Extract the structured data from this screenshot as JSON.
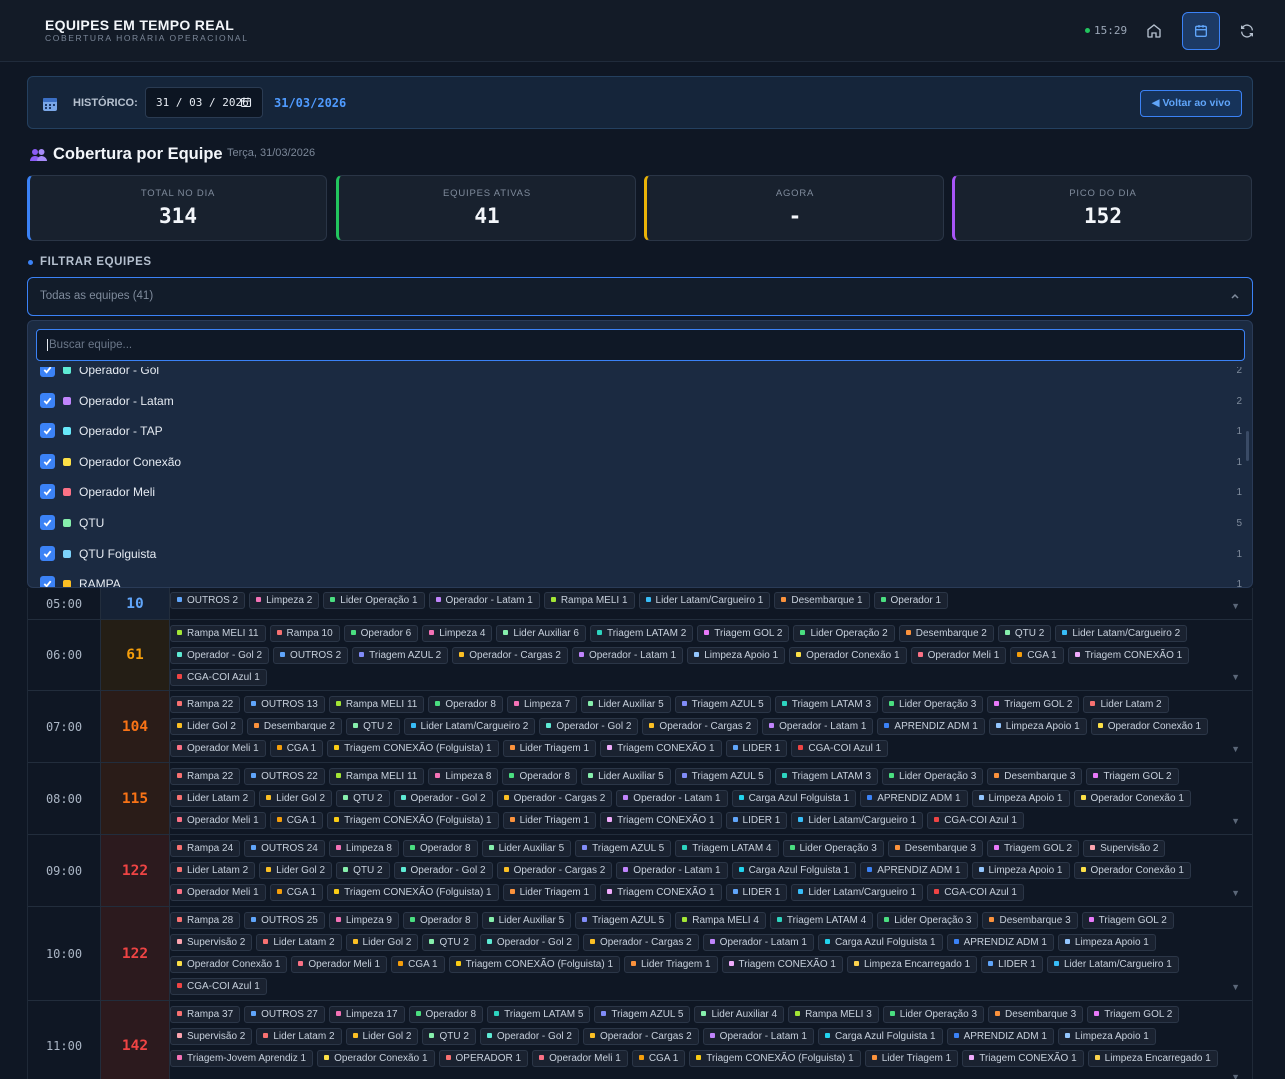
{
  "header": {
    "title": "EQUIPES EM TEMPO REAL",
    "subtitle": "COBERTURA HORÁRIA OPERACIONAL",
    "clock": "15:29"
  },
  "history": {
    "label": "HISTÓRICO:",
    "date_value": "31 / 03 / 2026",
    "date_display": "31/03/2026",
    "live_button": "◀ Voltar ao vivo"
  },
  "section": {
    "title": "Cobertura por Equipe",
    "date": "Terça, 31/03/2026"
  },
  "stats": [
    {
      "label": "TOTAL NO DIA",
      "value": "314"
    },
    {
      "label": "EQUIPES ATIVAS",
      "value": "41"
    },
    {
      "label": "AGORA",
      "value": "-"
    },
    {
      "label": "PICO DO DIA",
      "value": "152"
    }
  ],
  "filter": {
    "title": "FILTRAR EQUIPES",
    "selected": "Todas as equipes (41)",
    "search_placeholder": "Buscar equipe...",
    "items": [
      {
        "name": "Operador - Gol",
        "count": "2",
        "color": "#5eead4"
      },
      {
        "name": "Operador - Latam",
        "count": "2",
        "color": "#c084fc"
      },
      {
        "name": "Operador - TAP",
        "count": "1",
        "color": "#67e8f9"
      },
      {
        "name": "Operador Conexão",
        "count": "1",
        "color": "#fde047"
      },
      {
        "name": "Operador Meli",
        "count": "1",
        "color": "#fb7185"
      },
      {
        "name": "QTU",
        "count": "5",
        "color": "#86efac"
      },
      {
        "name": "QTU Folguista",
        "count": "1",
        "color": "#7dd3fc"
      },
      {
        "name": "RAMPA",
        "count": "1",
        "color": "#fbbf24"
      }
    ]
  },
  "hours": [
    {
      "hour": "05:00",
      "count": "10",
      "count_color": "#60a5fa",
      "bg": "#162235",
      "tags": [
        [
          "OUTROS 2",
          "#60a5fa"
        ],
        [
          "Limpeza 2",
          "#f472b6"
        ],
        [
          "Lider Operação 1",
          "#4ade80"
        ],
        [
          "Operador - Latam 1",
          "#c084fc"
        ],
        [
          "Rampa MELI 1",
          "#a3e635"
        ],
        [
          "Lider Latam/Cargueiro 1",
          "#38bdf8"
        ],
        [
          "Desembarque 1",
          "#fb923c"
        ],
        [
          "Operador 1",
          "#4ade80"
        ]
      ]
    },
    {
      "hour": "06:00",
      "count": "61",
      "count_color": "#f59e0b",
      "bg": "#241e15",
      "tags": [
        [
          "Rampa MELI 11",
          "#a3e635"
        ],
        [
          "Rampa 10",
          "#f87171"
        ],
        [
          "Operador 6",
          "#4ade80"
        ],
        [
          "Limpeza 4",
          "#f472b6"
        ],
        [
          "Lider Auxiliar 6",
          "#86efac"
        ],
        [
          "Triagem LATAM 2",
          "#2dd4bf"
        ],
        [
          "Triagem GOL 2",
          "#e879f9"
        ],
        [
          "Lider Operação 2",
          "#4ade80"
        ],
        [
          "Desembarque 2",
          "#fb923c"
        ],
        [
          "QTU 2",
          "#86efac"
        ],
        [
          "Lider Latam/Cargueiro 2",
          "#38bdf8"
        ],
        [
          "Operador - Gol 2",
          "#5eead4"
        ],
        [
          "OUTROS 2",
          "#60a5fa"
        ],
        [
          "Triagem AZUL 2",
          "#818cf8"
        ],
        [
          "Operador - Cargas 2",
          "#fbbf24"
        ],
        [
          "Operador - Latam 1",
          "#c084fc"
        ],
        [
          "Limpeza Apoio 1",
          "#93c5fd"
        ],
        [
          "Operador Conexão 1",
          "#fde047"
        ],
        [
          "Operador Meli 1",
          "#fb7185"
        ],
        [
          "CGA 1",
          "#f59e0b"
        ],
        [
          "Triagem CONEXÃO 1",
          "#f0abfc"
        ],
        [
          "CGA-COI Azul 1",
          "#ef4444"
        ]
      ]
    },
    {
      "hour": "07:00",
      "count": "104",
      "count_color": "#f97316",
      "bg": "#2a1c18",
      "tags": [
        [
          "Rampa 22",
          "#f87171"
        ],
        [
          "OUTROS 13",
          "#60a5fa"
        ],
        [
          "Rampa MELI 11",
          "#a3e635"
        ],
        [
          "Operador 8",
          "#4ade80"
        ],
        [
          "Limpeza 7",
          "#f472b6"
        ],
        [
          "Lider Auxiliar 5",
          "#86efac"
        ],
        [
          "Triagem AZUL 5",
          "#818cf8"
        ],
        [
          "Triagem LATAM 3",
          "#2dd4bf"
        ],
        [
          "Lider Operação 3",
          "#4ade80"
        ],
        [
          "Triagem GOL 2",
          "#e879f9"
        ],
        [
          "Lider Latam 2",
          "#f87171"
        ],
        [
          "Lider Gol 2",
          "#fbbf24"
        ],
        [
          "Desembarque 2",
          "#fb923c"
        ],
        [
          "QTU 2",
          "#86efac"
        ],
        [
          "Lider Latam/Cargueiro 2",
          "#38bdf8"
        ],
        [
          "Operador - Gol 2",
          "#5eead4"
        ],
        [
          "Operador - Cargas 2",
          "#fbbf24"
        ],
        [
          "Operador - Latam 1",
          "#c084fc"
        ],
        [
          "APRENDIZ ADM 1",
          "#3b82f6"
        ],
        [
          "Limpeza Apoio 1",
          "#93c5fd"
        ],
        [
          "Operador Conexão 1",
          "#fde047"
        ],
        [
          "Operador Meli 1",
          "#fb7185"
        ],
        [
          "CGA 1",
          "#f59e0b"
        ],
        [
          "Triagem CONEXÃO (Folguista) 1",
          "#facc15"
        ],
        [
          "Lider Triagem 1",
          "#fb923c"
        ],
        [
          "Triagem CONEXÃO 1",
          "#f0abfc"
        ],
        [
          "LIDER 1",
          "#60a5fa"
        ],
        [
          "CGA-COI Azul 1",
          "#ef4444"
        ]
      ]
    },
    {
      "hour": "08:00",
      "count": "115",
      "count_color": "#f97316",
      "bg": "#2a1c18",
      "tags": [
        [
          "Rampa 22",
          "#f87171"
        ],
        [
          "OUTROS 22",
          "#60a5fa"
        ],
        [
          "Rampa MELI 11",
          "#a3e635"
        ],
        [
          "Limpeza 8",
          "#f472b6"
        ],
        [
          "Operador 8",
          "#4ade80"
        ],
        [
          "Lider Auxiliar 5",
          "#86efac"
        ],
        [
          "Triagem AZUL 5",
          "#818cf8"
        ],
        [
          "Triagem LATAM 3",
          "#2dd4bf"
        ],
        [
          "Lider Operação 3",
          "#4ade80"
        ],
        [
          "Desembarque 3",
          "#fb923c"
        ],
        [
          "Triagem GOL 2",
          "#e879f9"
        ],
        [
          "Lider Latam 2",
          "#f87171"
        ],
        [
          "Lider Gol 2",
          "#fbbf24"
        ],
        [
          "QTU 2",
          "#86efac"
        ],
        [
          "Operador - Gol 2",
          "#5eead4"
        ],
        [
          "Operador - Cargas 2",
          "#fbbf24"
        ],
        [
          "Operador - Latam 1",
          "#c084fc"
        ],
        [
          "Carga Azul Folguista 1",
          "#22d3ee"
        ],
        [
          "APRENDIZ ADM 1",
          "#3b82f6"
        ],
        [
          "Limpeza Apoio 1",
          "#93c5fd"
        ],
        [
          "Operador Conexão 1",
          "#fde047"
        ],
        [
          "Operador Meli 1",
          "#fb7185"
        ],
        [
          "CGA 1",
          "#f59e0b"
        ],
        [
          "Triagem CONEXÃO (Folguista) 1",
          "#facc15"
        ],
        [
          "Lider Triagem 1",
          "#fb923c"
        ],
        [
          "Triagem CONEXÃO 1",
          "#f0abfc"
        ],
        [
          "LIDER 1",
          "#60a5fa"
        ],
        [
          "Lider Latam/Cargueiro 1",
          "#38bdf8"
        ],
        [
          "CGA-COI Azul 1",
          "#ef4444"
        ]
      ]
    },
    {
      "hour": "09:00",
      "count": "122",
      "count_color": "#ef4444",
      "bg": "#2c1a1e",
      "tags": [
        [
          "Rampa 24",
          "#f87171"
        ],
        [
          "OUTROS 24",
          "#60a5fa"
        ],
        [
          "Limpeza 8",
          "#f472b6"
        ],
        [
          "Operador 8",
          "#4ade80"
        ],
        [
          "Lider Auxiliar 5",
          "#86efac"
        ],
        [
          "Triagem AZUL 5",
          "#818cf8"
        ],
        [
          "Triagem LATAM 4",
          "#2dd4bf"
        ],
        [
          "Lider Operação 3",
          "#4ade80"
        ],
        [
          "Desembarque 3",
          "#fb923c"
        ],
        [
          "Triagem GOL 2",
          "#e879f9"
        ],
        [
          "Supervisão 2",
          "#fda4af"
        ],
        [
          "Lider Latam 2",
          "#f87171"
        ],
        [
          "Lider Gol 2",
          "#fbbf24"
        ],
        [
          "QTU 2",
          "#86efac"
        ],
        [
          "Operador - Gol 2",
          "#5eead4"
        ],
        [
          "Operador - Cargas 2",
          "#fbbf24"
        ],
        [
          "Operador - Latam 1",
          "#c084fc"
        ],
        [
          "Carga Azul Folguista 1",
          "#22d3ee"
        ],
        [
          "APRENDIZ ADM 1",
          "#3b82f6"
        ],
        [
          "Limpeza Apoio 1",
          "#93c5fd"
        ],
        [
          "Operador Conexão 1",
          "#fde047"
        ],
        [
          "Operador Meli 1",
          "#fb7185"
        ],
        [
          "CGA 1",
          "#f59e0b"
        ],
        [
          "Triagem CONEXÃO (Folguista) 1",
          "#facc15"
        ],
        [
          "Lider Triagem 1",
          "#fb923c"
        ],
        [
          "Triagem CONEXÃO 1",
          "#f0abfc"
        ],
        [
          "LIDER 1",
          "#60a5fa"
        ],
        [
          "Lider Latam/Cargueiro 1",
          "#38bdf8"
        ],
        [
          "CGA-COI Azul 1",
          "#ef4444"
        ]
      ]
    },
    {
      "hour": "10:00",
      "count": "122",
      "count_color": "#ef4444",
      "bg": "#2c1a1e",
      "tags": [
        [
          "Rampa 28",
          "#f87171"
        ],
        [
          "OUTROS 25",
          "#60a5fa"
        ],
        [
          "Limpeza 9",
          "#f472b6"
        ],
        [
          "Operador 8",
          "#4ade80"
        ],
        [
          "Lider Auxiliar 5",
          "#86efac"
        ],
        [
          "Triagem AZUL 5",
          "#818cf8"
        ],
        [
          "Rampa MELI 4",
          "#a3e635"
        ],
        [
          "Triagem LATAM 4",
          "#2dd4bf"
        ],
        [
          "Lider Operação 3",
          "#4ade80"
        ],
        [
          "Desembarque 3",
          "#fb923c"
        ],
        [
          "Triagem GOL 2",
          "#e879f9"
        ],
        [
          "Supervisão 2",
          "#fda4af"
        ],
        [
          "Lider Latam 2",
          "#f87171"
        ],
        [
          "Lider Gol 2",
          "#fbbf24"
        ],
        [
          "QTU 2",
          "#86efac"
        ],
        [
          "Operador - Gol 2",
          "#5eead4"
        ],
        [
          "Operador - Cargas 2",
          "#fbbf24"
        ],
        [
          "Operador - Latam 1",
          "#c084fc"
        ],
        [
          "Carga Azul Folguista 1",
          "#22d3ee"
        ],
        [
          "APRENDIZ ADM 1",
          "#3b82f6"
        ],
        [
          "Limpeza Apoio 1",
          "#93c5fd"
        ],
        [
          "Operador Conexão 1",
          "#fde047"
        ],
        [
          "Operador Meli 1",
          "#fb7185"
        ],
        [
          "CGA 1",
          "#f59e0b"
        ],
        [
          "Triagem CONEXÃO (Folguista) 1",
          "#facc15"
        ],
        [
          "Lider Triagem 1",
          "#fb923c"
        ],
        [
          "Triagem CONEXÃO 1",
          "#f0abfc"
        ],
        [
          "Limpeza Encarregado 1",
          "#fcd34d"
        ],
        [
          "LIDER 1",
          "#60a5fa"
        ],
        [
          "Lider Latam/Cargueiro 1",
          "#38bdf8"
        ],
        [
          "CGA-COI Azul 1",
          "#ef4444"
        ]
      ]
    },
    {
      "hour": "11:00",
      "count": "142",
      "count_color": "#ef4444",
      "bg": "#2c1a1e",
      "tags": [
        [
          "Rampa 37",
          "#f87171"
        ],
        [
          "OUTROS 27",
          "#60a5fa"
        ],
        [
          "Limpeza 17",
          "#f472b6"
        ],
        [
          "Operador 8",
          "#4ade80"
        ],
        [
          "Triagem LATAM 5",
          "#2dd4bf"
        ],
        [
          "Triagem AZUL 5",
          "#818cf8"
        ],
        [
          "Lider Auxiliar 4",
          "#86efac"
        ],
        [
          "Rampa MELI 3",
          "#a3e635"
        ],
        [
          "Lider Operação 3",
          "#4ade80"
        ],
        [
          "Desembarque 3",
          "#fb923c"
        ],
        [
          "Triagem GOL 2",
          "#e879f9"
        ],
        [
          "Supervisão 2",
          "#fda4af"
        ],
        [
          "Lider Latam 2",
          "#f87171"
        ],
        [
          "Lider Gol 2",
          "#fbbf24"
        ],
        [
          "QTU 2",
          "#86efac"
        ],
        [
          "Operador - Gol 2",
          "#5eead4"
        ],
        [
          "Operador - Cargas 2",
          "#fbbf24"
        ],
        [
          "Operador - Latam 1",
          "#c084fc"
        ],
        [
          "Carga Azul Folguista 1",
          "#22d3ee"
        ],
        [
          "APRENDIZ ADM 1",
          "#3b82f6"
        ],
        [
          "Limpeza Apoio 1",
          "#93c5fd"
        ],
        [
          "Triagem-Jovem Aprendiz 1",
          "#f472b6"
        ],
        [
          "Operador Conexão 1",
          "#fde047"
        ],
        [
          "OPERADOR 1",
          "#f87171"
        ],
        [
          "Operador Meli 1",
          "#fb7185"
        ],
        [
          "CGA 1",
          "#f59e0b"
        ],
        [
          "Triagem CONEXÃO (Folguista) 1",
          "#facc15"
        ],
        [
          "Lider Triagem 1",
          "#fb923c"
        ],
        [
          "Triagem CONEXÃO 1",
          "#f0abfc"
        ],
        [
          "Limpeza Encarregado 1",
          "#fcd34d"
        ]
      ]
    }
  ]
}
